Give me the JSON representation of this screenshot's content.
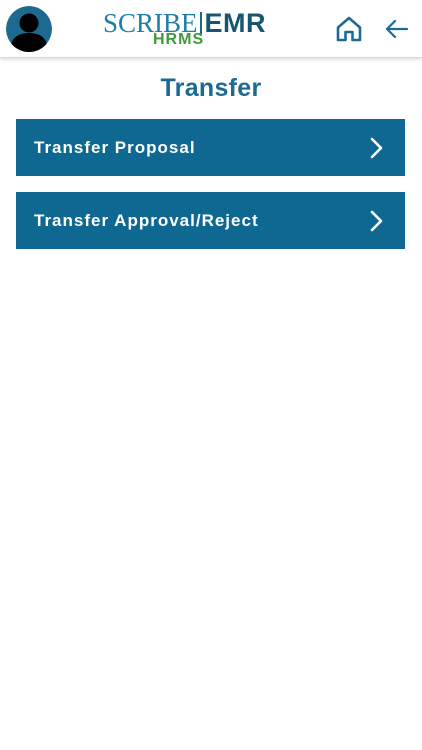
{
  "header": {
    "avatar": "user-avatar-icon",
    "logo": {
      "brand": "SCRIBE",
      "product": "EMR",
      "sub": "HRMS"
    },
    "home_icon": "home-icon",
    "back_icon": "back-arrow-icon"
  },
  "page": {
    "title": "Transfer"
  },
  "menu": {
    "items": [
      {
        "label": "Transfer Proposal",
        "icon": "chevron-right-icon"
      },
      {
        "label": "Transfer Approval/Reject",
        "icon": "chevron-right-icon"
      }
    ]
  },
  "colors": {
    "primary": "#0e6891",
    "title": "#1a6a92",
    "logo_blue": "#1d7fa8",
    "logo_dark": "#16566e",
    "logo_green": "#3f9a3a",
    "icon_blue": "#1d6a96"
  }
}
